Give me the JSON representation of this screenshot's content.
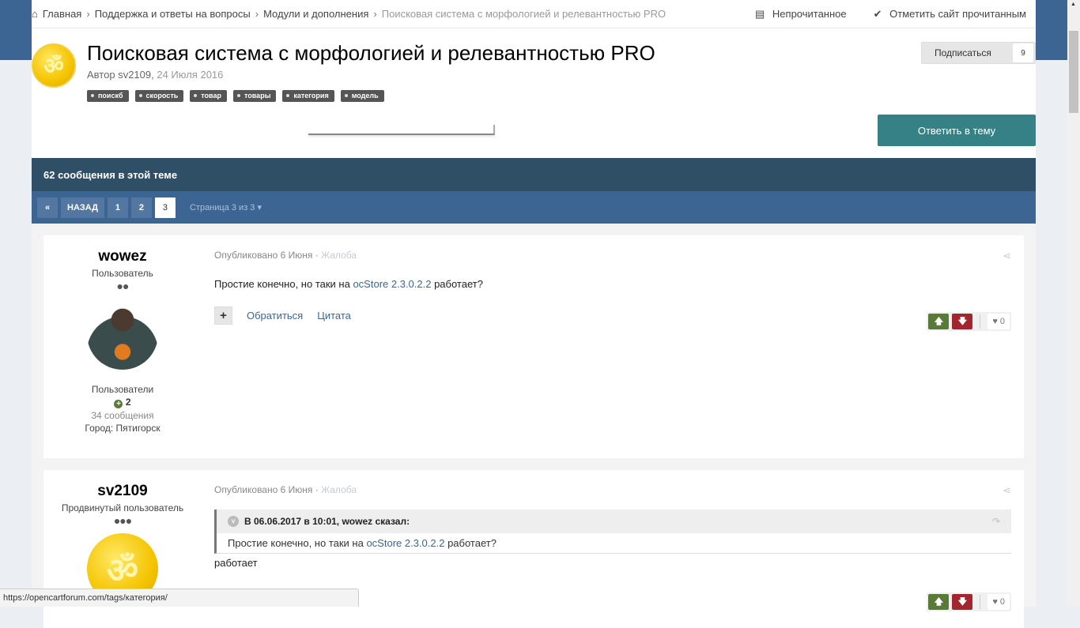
{
  "breadcrumb": {
    "items": [
      "Главная",
      "Поддержка и ответы на вопросы",
      "Модули и дополнения"
    ],
    "current": "Поисковая система с морфологией и релевантностью PRO"
  },
  "header_links": {
    "unread": "Непрочитанное",
    "mark_read": "Отметить сайт прочитанным"
  },
  "topic": {
    "title": "Поисковая система с морфологией и релевантностью PRO",
    "author_prefix": "Автор",
    "author": "sv2109",
    "date": "24 Июля 2016",
    "tags": [
      "поискб",
      "скорость",
      "товар",
      "товары",
      "категория",
      "модель"
    ],
    "subscribe_label": "Подписаться",
    "subscribe_count": "9",
    "reply_label": "Ответить в тему",
    "icon_glyph": "ॐ"
  },
  "thread": {
    "count_label": "62 сообщения в этой теме"
  },
  "pagination": {
    "back": "НАЗАД",
    "pages": [
      "1",
      "2",
      "3"
    ],
    "current": "3",
    "info": "Страница 3 из 3"
  },
  "posts": [
    {
      "username": "wowez",
      "rank": "Пользователь",
      "dots": "●●",
      "group": "Пользователи",
      "rep": "2",
      "count": "34 сообщения",
      "city_label": "Город:",
      "city": "Пятигорск",
      "posted": "Опубликовано 6 Июня",
      "report": "Жалоба",
      "text_before": "Простие конечно, но таки на ",
      "text_link": "ocStore 2.3.0.2.2",
      "text_after": " работает?",
      "mention": "Обратиться",
      "quote": "Цитата",
      "likes": "0"
    },
    {
      "username": "sv2109",
      "rank": "Продвинутый пользователь",
      "dots": "●●●",
      "posted": "Опубликовано 6 Июня",
      "report": "Жалоба",
      "quote_header": "В 06.06.2017 в 10:01, wowez сказал:",
      "quote_before": "Простие конечно, но таки на ",
      "quote_link": "ocStore 2.3.0.2.2",
      "quote_after": " работает?",
      "text": "работает",
      "likes": "0"
    }
  ],
  "status_url": "https://opencartforum.com/tags/категория/"
}
